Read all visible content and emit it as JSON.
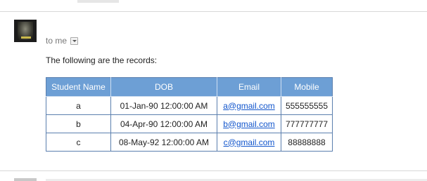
{
  "message": {
    "to_label": "to me",
    "intro_text": "The following are the records:"
  },
  "records_table": {
    "headers": {
      "name": "Student Name",
      "dob": "DOB",
      "email": "Email",
      "mobile": "Mobile"
    },
    "rows": [
      {
        "name": "a",
        "dob": "01-Jan-90 12:00:00 AM",
        "email": "a@gmail.com",
        "mobile": "555555555"
      },
      {
        "name": "b",
        "dob": "04-Apr-90 12:00:00 AM",
        "email": "b@gmail.com",
        "mobile": "777777777"
      },
      {
        "name": "c",
        "dob": "08-May-92 12:00:00 AM",
        "email": "c@gmail.com",
        "mobile": "88888888"
      }
    ]
  },
  "colors": {
    "header_bg": "#6d9fd5",
    "border": "#5b7fae",
    "link": "#1155cc"
  },
  "icons": {
    "sender_avatar": "avatar",
    "details_dropdown": "chevron-down-icon"
  }
}
